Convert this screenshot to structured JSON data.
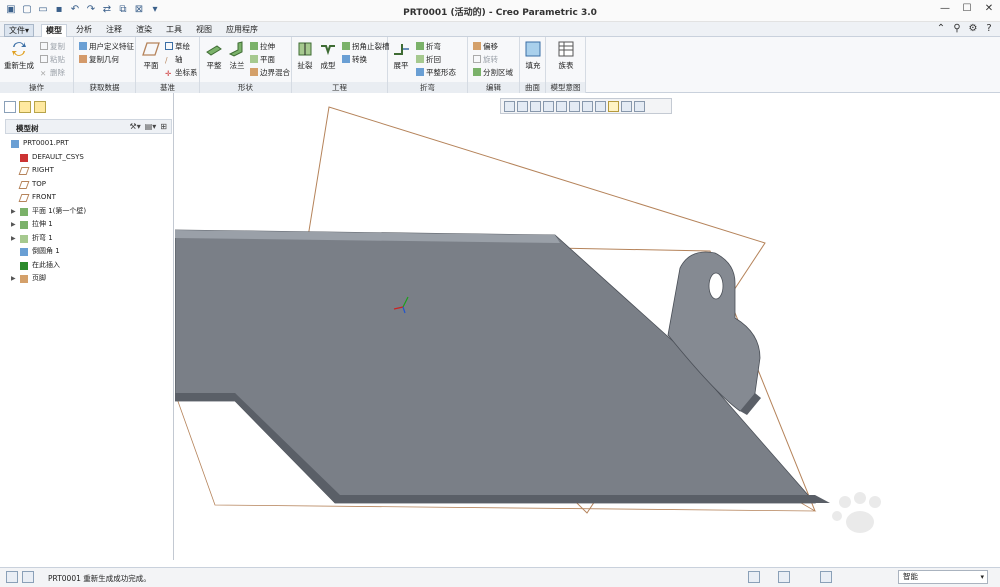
{
  "window": {
    "title": "PRT0001 (活动的) - Creo Parametric 3.0"
  },
  "menu_tabs": [
    {
      "label": "文件▾"
    },
    {
      "label": "模型"
    },
    {
      "label": "分析"
    },
    {
      "label": "注释"
    },
    {
      "label": "渲染"
    },
    {
      "label": "工具"
    },
    {
      "label": "视图"
    },
    {
      "label": "应用程序"
    }
  ],
  "ribbon": {
    "ops": {
      "regen": "重新生成",
      "copy": "复制",
      "paste": "粘贴",
      "delete": "删除",
      "label": "操作"
    },
    "getdata": {
      "udf": "用户定义特征",
      "copygeom": "复制几何",
      "label": "获取数据"
    },
    "datum": {
      "plane": "平面",
      "sketch": "草绘",
      "axis": "轴",
      "csys": "坐标系",
      "label": "基准"
    },
    "shapes": {
      "flat": "平整",
      "flange": "法兰",
      "extrude": "拉伸",
      "plane": "平面",
      "boundary": "边界混合",
      "label": "形状"
    },
    "engineering": {
      "punch": "扯裂",
      "form": "成型",
      "corner": "拐角止裂槽",
      "convert": "转换",
      "label": "工程"
    },
    "bend": {
      "unbend": "展平",
      "bend": "折弯",
      "bendback": "折回",
      "flatform": "平整形态",
      "label": "折弯"
    },
    "edit": {
      "offset": "偏移",
      "rotate": "旋转",
      "split": "分割区域",
      "label": "编辑"
    },
    "surface": {
      "fill": "填充",
      "label": "曲面"
    },
    "modelintent": {
      "table": "族表",
      "label": "模型意图"
    }
  },
  "model_tree": {
    "header": "模型树",
    "nodes": [
      {
        "label": "PRT0001.PRT",
        "icon": "part-icon",
        "expandable": false
      },
      {
        "label": "DEFAULT_CSYS",
        "icon": "csys-icon",
        "expandable": false
      },
      {
        "label": "RIGHT",
        "icon": "datum-plane-icon",
        "expandable": false
      },
      {
        "label": "TOP",
        "icon": "datum-plane-icon",
        "expandable": false
      },
      {
        "label": "FRONT",
        "icon": "datum-plane-icon",
        "expandable": false
      },
      {
        "label": "平面 1(第一个壁)",
        "icon": "flat-wall-icon",
        "expandable": true
      },
      {
        "label": "拉伸 1",
        "icon": "extrude-icon",
        "expandable": true
      },
      {
        "label": "折弯 1",
        "icon": "bend-icon",
        "expandable": true
      },
      {
        "label": "倒圆角 1",
        "icon": "round-icon",
        "expandable": false
      },
      {
        "label": "在此插入",
        "icon": "insert-here-icon",
        "expandable": false
      },
      {
        "label": "页脚",
        "icon": "footer-icon",
        "expandable": true
      }
    ]
  },
  "status": {
    "message": "PRT0001 重新生成成功完成。",
    "filter": "智能"
  },
  "colors": {
    "part_face": "#7a7f87",
    "part_edge": "#4a4f57",
    "datum_plane": "#b5835a",
    "accent": "#3a6ea5"
  }
}
